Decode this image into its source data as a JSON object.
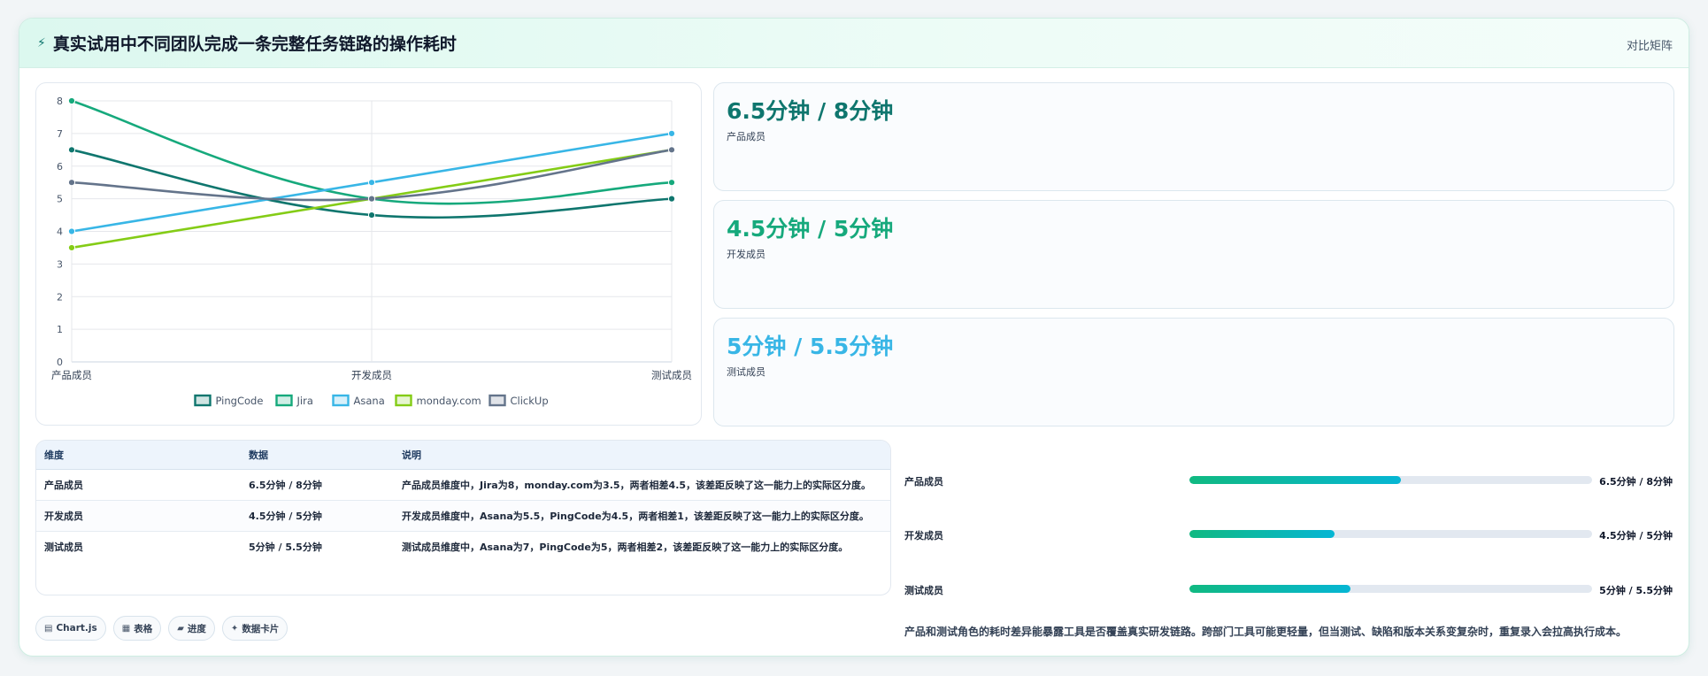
{
  "header": {
    "icon": "bolt-icon",
    "title": "真实试用中不同团队完成一条完整任务链路的操作耗时",
    "right_label": "对比矩阵"
  },
  "chart_data": {
    "type": "line",
    "categories": [
      "产品成员",
      "开发成员",
      "测试成员"
    ],
    "series": [
      {
        "name": "PingCode",
        "values": [
          6.5,
          4.5,
          5
        ],
        "color": "#0f766e"
      },
      {
        "name": "Jira",
        "values": [
          8,
          5,
          5.5
        ],
        "color": "#16a97c"
      },
      {
        "name": "Asana",
        "values": [
          4,
          5.5,
          7
        ],
        "color": "#38b6e6"
      },
      {
        "name": "monday.com",
        "values": [
          3.5,
          5,
          6.5
        ],
        "color": "#84cc16"
      },
      {
        "name": "ClickUp",
        "values": [
          5.5,
          5,
          6.5
        ],
        "color": "#64748b"
      }
    ],
    "ylim": [
      0,
      8
    ],
    "yticks": [
      "0",
      "1",
      "2",
      "3",
      "4",
      "5",
      "6",
      "7",
      "8"
    ],
    "grid": true,
    "legend": "bottom",
    "title": "",
    "xlabel": "",
    "ylabel": ""
  },
  "kpis": [
    {
      "value": "6.5分钟 / 8分钟",
      "label": "产品成员",
      "color": "#0f766e"
    },
    {
      "value": "4.5分钟 / 5分钟",
      "label": "开发成员",
      "color": "#16a97c"
    },
    {
      "value": "5分钟 / 5.5分钟",
      "label": "测试成员",
      "color": "#38b6e6"
    }
  ],
  "table": {
    "headers": [
      "维度",
      "数据",
      "说明"
    ],
    "rows": [
      {
        "dim": "产品成员",
        "data": "6.5分钟 / 8分钟",
        "desc": "产品成员维度中，Jira为8，monday.com为3.5，两者相差4.5，该差距反映了这一能力上的实际区分度。"
      },
      {
        "dim": "开发成员",
        "data": "4.5分钟 / 5分钟",
        "desc": "开发成员维度中，Asana为5.5，PingCode为4.5，两者相差1，该差距反映了这一能力上的实际区分度。"
      },
      {
        "dim": "测试成员",
        "data": "5分钟 / 5.5分钟",
        "desc": "测试成员维度中，Asana为7，PingCode为5，两者相差2，该差距反映了这一能力上的实际区分度。"
      }
    ]
  },
  "progress": [
    {
      "label": "产品成员",
      "value_text": "6.5分钟 / 8分钟",
      "fraction": 0.525
    },
    {
      "label": "开发成员",
      "value_text": "4.5分钟 / 5分钟",
      "fraction": 0.36
    },
    {
      "label": "测试成员",
      "value_text": "5分钟 / 5.5分钟",
      "fraction": 0.4
    }
  ],
  "note": "产品和测试角色的耗时差异能暴露工具是否覆盖真实研发链路。跨部门工具可能更轻量，但当测试、缺陷和版本关系变复杂时，重复录入会拉高执行成本。",
  "chips": [
    {
      "icon": "chart-icon",
      "glyph": "▤",
      "label": "Chart.js"
    },
    {
      "icon": "table-icon",
      "glyph": "▦",
      "label": "表格"
    },
    {
      "icon": "progress-icon",
      "glyph": "▰",
      "label": "进度"
    },
    {
      "icon": "sparkle-icon",
      "glyph": "✦",
      "label": "数据卡片"
    }
  ]
}
